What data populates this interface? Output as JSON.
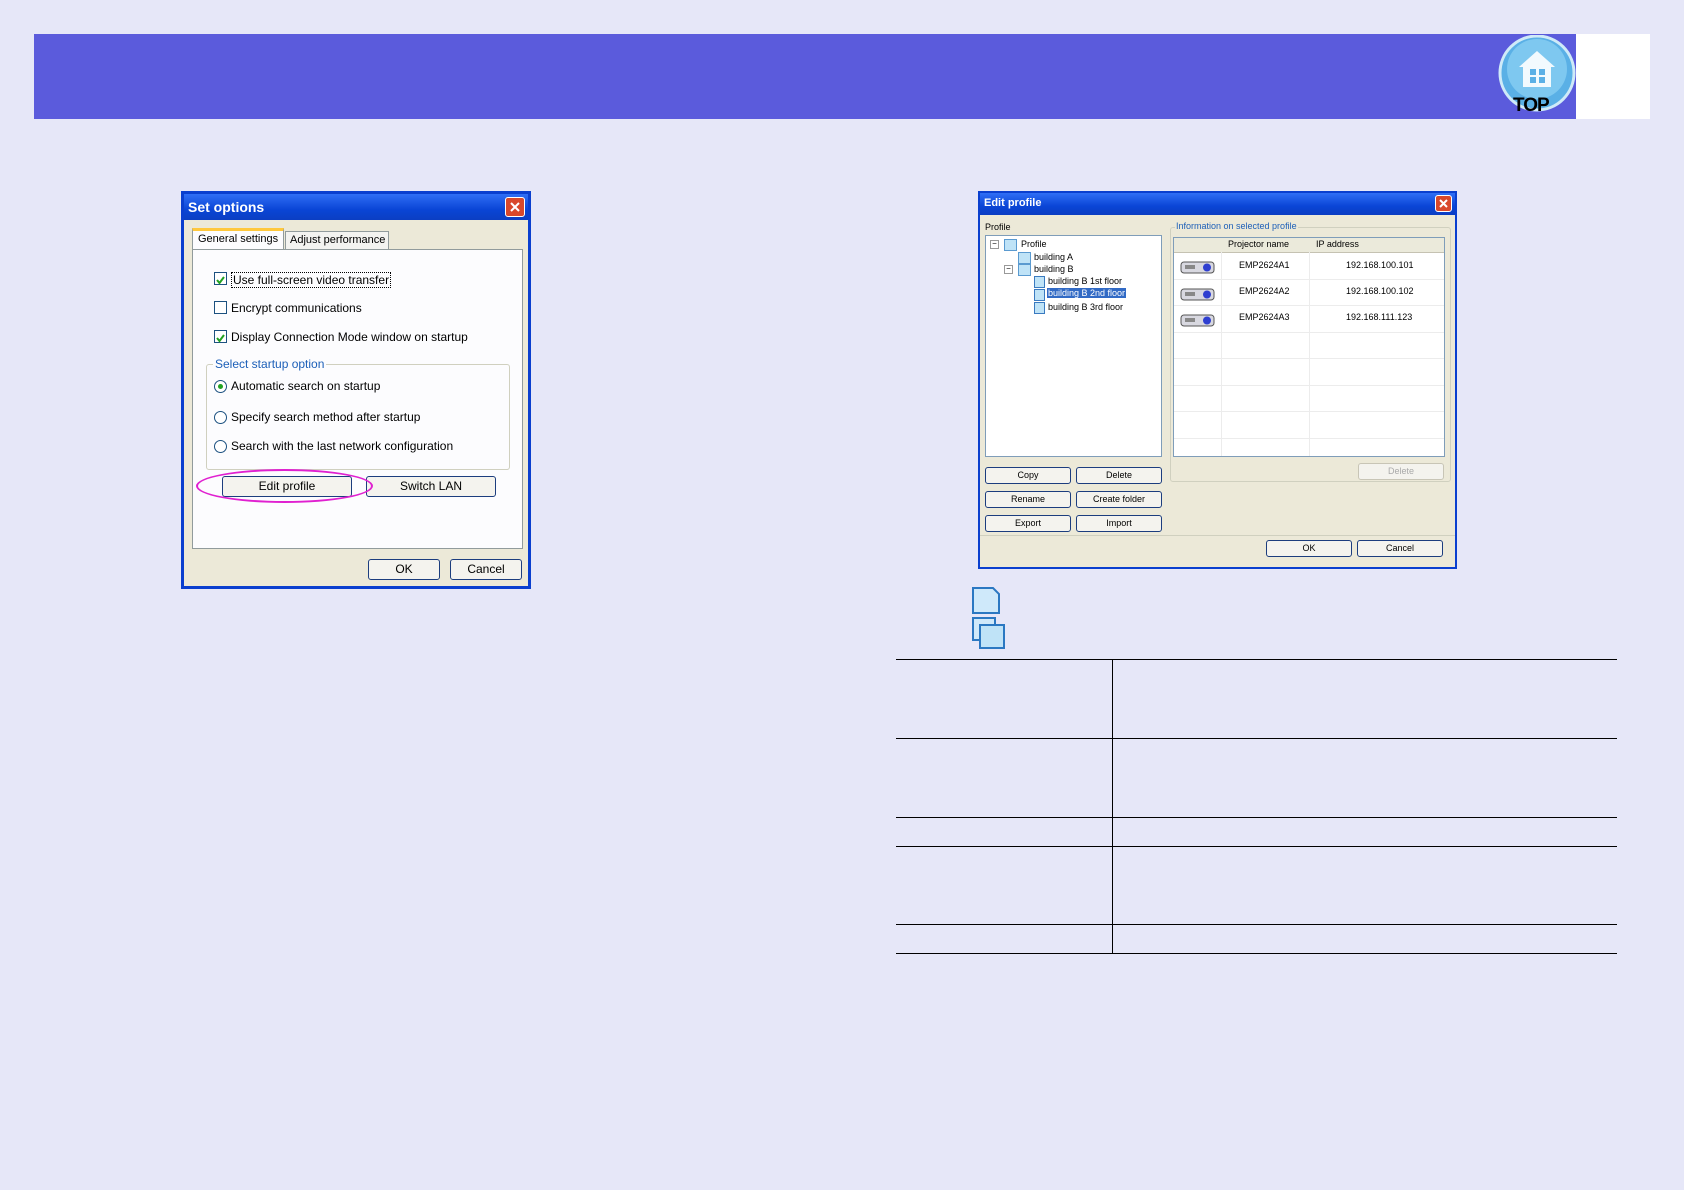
{
  "header": {
    "logo_text": "TOP"
  },
  "set_options": {
    "title": "Set options",
    "tabs": [
      {
        "label": "General settings",
        "active": true
      },
      {
        "label": "Adjust performance",
        "active": false
      }
    ],
    "checkboxes": [
      {
        "label": "Use full-screen video transfer",
        "checked": true
      },
      {
        "label": "Encrypt communications",
        "checked": false
      },
      {
        "label": "Display Connection Mode window on startup",
        "checked": true
      }
    ],
    "group_label": "Select startup option",
    "radios": [
      {
        "label": "Automatic search on startup",
        "selected": true
      },
      {
        "label": "Specify search method after startup",
        "selected": false
      },
      {
        "label": "Search with the last network configuration",
        "selected": false
      }
    ],
    "edit_profile_label": "Edit profile",
    "switch_lan_label": "Switch LAN",
    "ok_label": "OK",
    "cancel_label": "Cancel",
    "highlight_color": "#e020d0"
  },
  "edit_profile": {
    "title": "Edit profile",
    "profile_label": "Profile",
    "tree": [
      {
        "label": "Profile",
        "selected": false
      },
      {
        "label": "building A",
        "selected": false
      },
      {
        "label": "building B",
        "selected": false
      },
      {
        "label": "building B  1st floor",
        "selected": false
      },
      {
        "label": "building B  2nd floor",
        "selected": true
      },
      {
        "label": "building B  3rd floor",
        "selected": false
      }
    ],
    "info_label": "Information on selected profile",
    "columns": [
      "Projector name",
      "IP address"
    ],
    "rows": [
      {
        "name": "EMP2624A1",
        "ip": "192.168.100.101"
      },
      {
        "name": "EMP2624A2",
        "ip": "192.168.100.102"
      },
      {
        "name": "EMP2624A3",
        "ip": "192.168.111.123"
      }
    ],
    "buttons": {
      "copy": "Copy",
      "delete": "Delete",
      "rename": "Rename",
      "create_folder": "Create folder",
      "export": "Export",
      "import": "Import",
      "delete_right": "Delete",
      "ok": "OK",
      "cancel": "Cancel"
    }
  }
}
